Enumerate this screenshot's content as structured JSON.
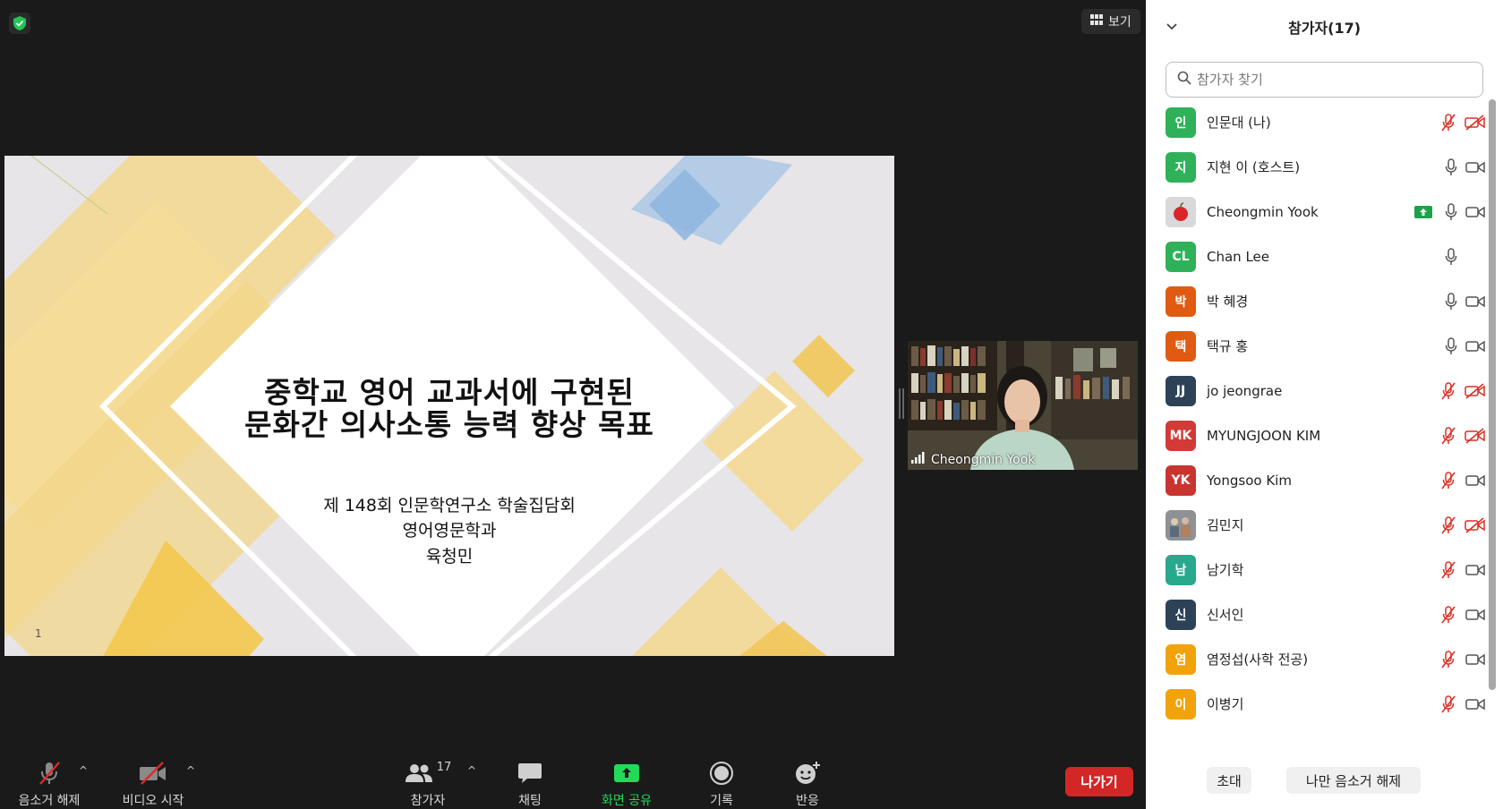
{
  "meeting": {
    "view_label": "보기",
    "slide": {
      "title_line1": "중학교 영어 교과서에 구현된",
      "title_line2": "문화간 의사소통 능력 향상 목표",
      "subtitle_line1": "제 148회 인문학연구소 학술집담회",
      "subtitle_line2": "영어영문학과",
      "subtitle_line3": "육청민",
      "page_number": "1"
    },
    "video": {
      "name": "Cheongmin Yook"
    }
  },
  "toolbar": {
    "unmute": "음소거 해제",
    "start_video": "비디오 시작",
    "participants": "참가자",
    "participants_count": "17",
    "chat": "채팅",
    "share_screen": "화면 공유",
    "record": "기록",
    "reactions": "반응",
    "leave": "나가기",
    "share_color": "#23d959",
    "leave_color": "#d32626"
  },
  "panel": {
    "title": "참가자(17)",
    "search_placeholder": "참가자 찾기",
    "invite": "초대",
    "unmute_me": "나만 음소거 해제",
    "participants": [
      {
        "avatar": "인",
        "color": "#2fb15a",
        "name": "인문대 (나)",
        "mic": "muted",
        "video": "off",
        "sharing": false
      },
      {
        "avatar": "지",
        "color": "#2fb15a",
        "name": "지현 이 (호스트)",
        "mic": "on",
        "video": "on",
        "sharing": false
      },
      {
        "avatar": "photo-apple",
        "color": "#cfcfcf",
        "name": "Cheongmin Yook",
        "mic": "on",
        "video": "on",
        "sharing": true
      },
      {
        "avatar": "CL",
        "color": "#2fb15a",
        "name": "Chan Lee",
        "mic": "on",
        "video": "none",
        "sharing": false
      },
      {
        "avatar": "박",
        "color": "#e05a12",
        "name": "박 혜경",
        "mic": "on",
        "video": "on",
        "sharing": false
      },
      {
        "avatar": "택",
        "color": "#e05a12",
        "name": "택규 홍",
        "mic": "on",
        "video": "on",
        "sharing": false
      },
      {
        "avatar": "JJ",
        "color": "#2e4257",
        "name": "jo jeongrae",
        "mic": "muted",
        "video": "off",
        "sharing": false
      },
      {
        "avatar": "MK",
        "color": "#d13a36",
        "name": "MYUNGJOON KIM",
        "mic": "muted",
        "video": "off",
        "sharing": false
      },
      {
        "avatar": "YK",
        "color": "#c8352f",
        "name": "Yongsoo Kim",
        "mic": "muted",
        "video": "on",
        "sharing": false
      },
      {
        "avatar": "photo-group",
        "color": "#7d8a8f",
        "name": "김민지",
        "mic": "muted",
        "video": "off",
        "sharing": false
      },
      {
        "avatar": "남",
        "color": "#28a88c",
        "name": "남기학",
        "mic": "muted",
        "video": "on",
        "sharing": false
      },
      {
        "avatar": "신",
        "color": "#2e4257",
        "name": "신서인",
        "mic": "muted",
        "video": "on",
        "sharing": false
      },
      {
        "avatar": "염",
        "color": "#f2a20a",
        "name": "염정섭(사학 전공)",
        "mic": "muted",
        "video": "on",
        "sharing": false
      },
      {
        "avatar": "이",
        "color": "#f2a20a",
        "name": "이병기",
        "mic": "muted",
        "video": "on",
        "sharing": false
      }
    ]
  }
}
